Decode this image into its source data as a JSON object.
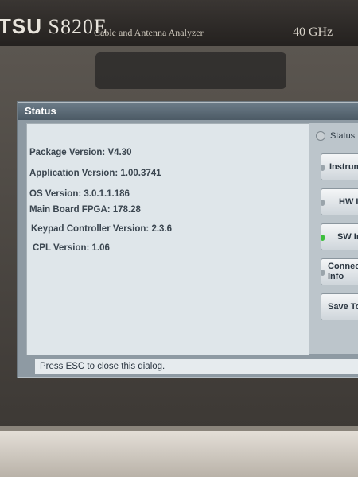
{
  "instrument": {
    "brand": "TSU",
    "model": "S820E",
    "subtitle": "Cable and Antenna Analyzer",
    "frequency": "40 GHz"
  },
  "dialog": {
    "title": "Status",
    "info_lines": [
      "Package Version: V4.30",
      "Application Version: 1.00.3741",
      "OS Version: 3.0.1.1.186",
      "Main Board FPGA: 178.28",
      "Keypad Controller Version: 2.3.6",
      "CPL Version: 1.06"
    ],
    "status_message": "Press ESC to close this dialog."
  },
  "side_menu": {
    "radio_label": "Status",
    "buttons": [
      {
        "label": "Instrum",
        "active": false
      },
      {
        "label": "HW I",
        "active": false
      },
      {
        "label": "SW In",
        "active": true
      },
      {
        "label": "Connect\nInfo",
        "active": false
      },
      {
        "label": "Save To",
        "active": false
      }
    ]
  }
}
